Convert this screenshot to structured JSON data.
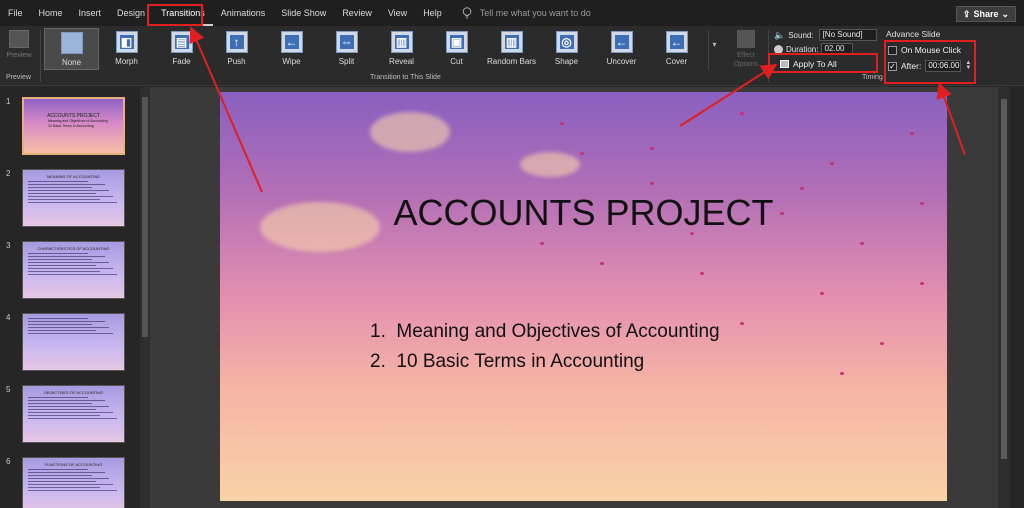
{
  "menu": {
    "items": [
      "File",
      "Home",
      "Insert",
      "Design",
      "Transitions",
      "Animations",
      "Slide Show",
      "Review",
      "View",
      "Help"
    ],
    "active": "Transitions",
    "tell_me_placeholder": "Tell me what you want to do",
    "share_label": "Share"
  },
  "ribbon": {
    "preview_label": "Preview",
    "preview_group": "Preview",
    "transitions_group": "Transition to This Slide",
    "timing_group": "Timing",
    "effect_options_label": "Effect Options",
    "transitions": [
      {
        "label": "None",
        "selected": true
      },
      {
        "label": "Morph"
      },
      {
        "label": "Fade"
      },
      {
        "label": "Push"
      },
      {
        "label": "Wipe"
      },
      {
        "label": "Split"
      },
      {
        "label": "Reveal"
      },
      {
        "label": "Cut"
      },
      {
        "label": "Random Bars"
      },
      {
        "label": "Shape"
      },
      {
        "label": "Uncover"
      },
      {
        "label": "Cover"
      }
    ],
    "timing": {
      "sound_label": "Sound:",
      "sound_value": "[No Sound]",
      "duration_label": "Duration:",
      "duration_value": "02.00",
      "apply_all_label": "Apply To All"
    },
    "advance": {
      "title": "Advance Slide",
      "on_mouse_click_label": "On Mouse Click",
      "on_mouse_click_checked": false,
      "after_label": "After:",
      "after_checked": true,
      "after_value": "00:06.00"
    }
  },
  "thumbnails": [
    {
      "num": "1",
      "title": "ACCOUNTS PROJECT"
    },
    {
      "num": "2",
      "title": "MEANING OF ACCOUNTING"
    },
    {
      "num": "3",
      "title": "CHARACTERISTICS OF ACCOUNTING"
    },
    {
      "num": "4",
      "title": ""
    },
    {
      "num": "5",
      "title": "OBJECTIVES OF ACCOUNTING"
    },
    {
      "num": "6",
      "title": "FUNCTIONS OF ACCOUNTING"
    }
  ],
  "slide": {
    "title": "ACCOUNTS PROJECT",
    "bullets": [
      "Meaning and Objectives of Accounting",
      "10 Basic Terms in Accounting"
    ]
  },
  "colors": {
    "annotation": "#e02020",
    "ribbon_bg": "#2b2b2b",
    "menubar_bg": "#1f1f1f"
  }
}
